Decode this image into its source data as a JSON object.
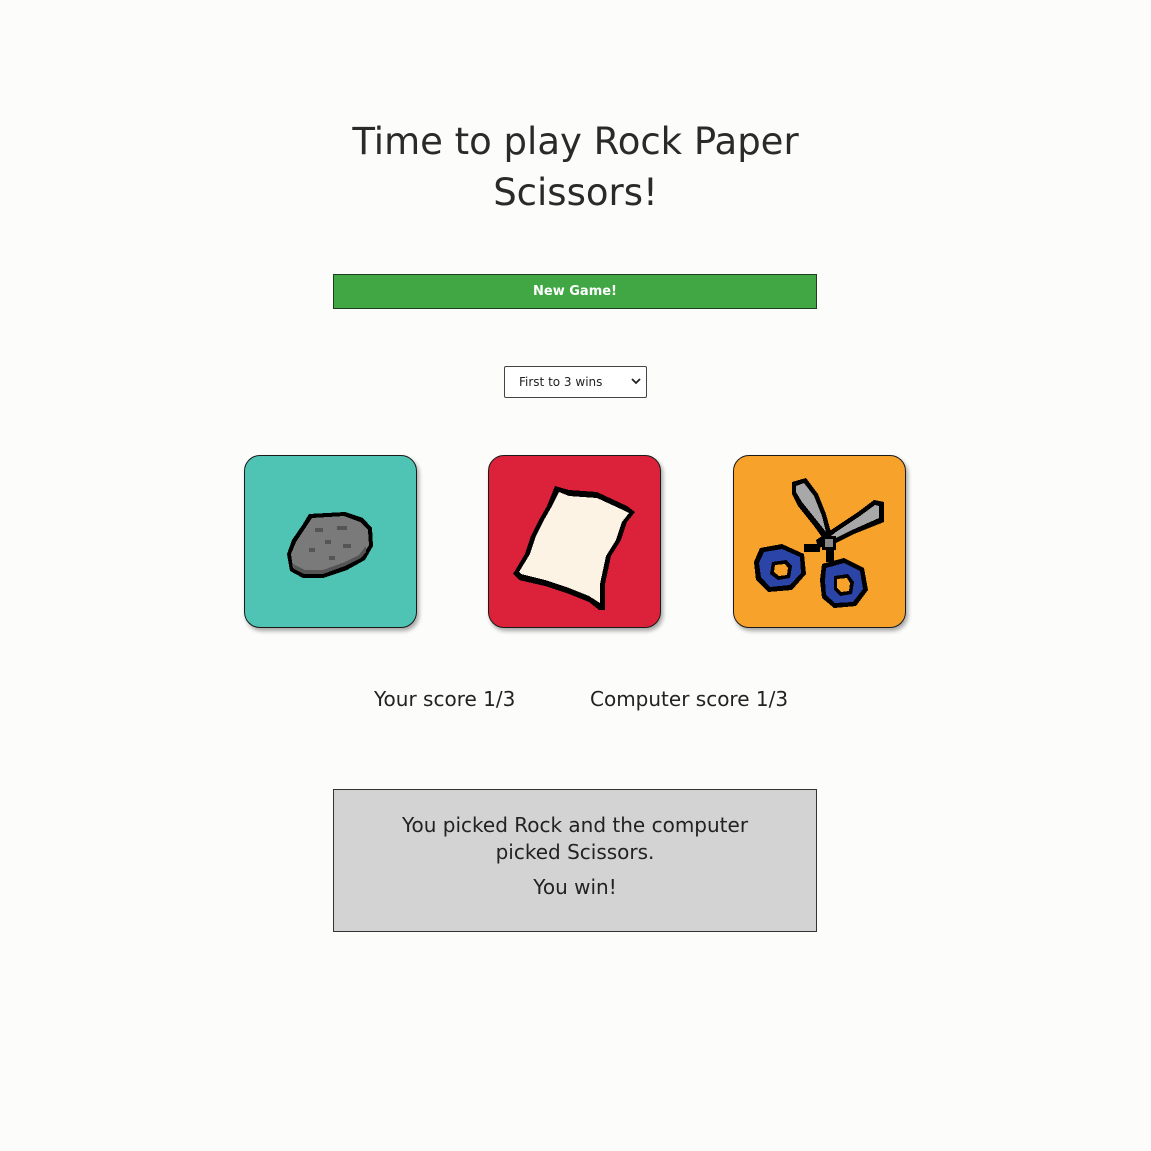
{
  "title": {
    "line1": "Time to play Rock Paper",
    "line2": "Scissors!"
  },
  "new_game_button": "New Game!",
  "rounds_select": {
    "selected": "First to 3 wins"
  },
  "choices": [
    {
      "name": "Rock",
      "icon": "rock-icon",
      "color": "#4fc4b5"
    },
    {
      "name": "Paper",
      "icon": "paper-icon",
      "color": "#dc223a"
    },
    {
      "name": "Scissors",
      "icon": "scissors-icon",
      "color": "#f6a22b"
    }
  ],
  "scores": {
    "you": "Your score 1/3",
    "computer": "Computer score 1/3"
  },
  "result": {
    "message": "You picked Rock and the computer picked Scissors.",
    "outcome": "You win!"
  },
  "colors": {
    "new_game_bg": "#41a745",
    "result_bg": "#d3d3d3",
    "page_bg": "#fcfdfb"
  }
}
